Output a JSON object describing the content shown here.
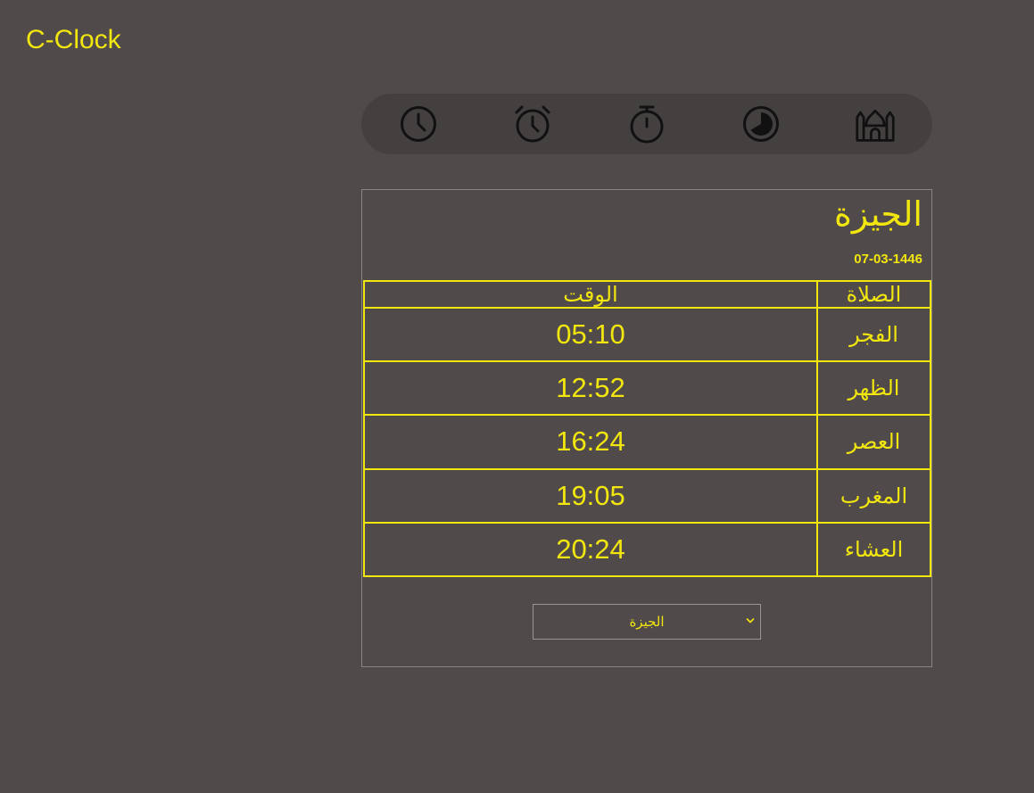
{
  "app": {
    "brand": "C-Clock"
  },
  "nav": {
    "items": [
      {
        "icon": "clock-icon"
      },
      {
        "icon": "alarm-clock-icon"
      },
      {
        "icon": "stopwatch-icon"
      },
      {
        "icon": "timer-icon"
      },
      {
        "icon": "mosque-icon"
      }
    ],
    "active_icon": "mosque-icon"
  },
  "prayer": {
    "city": "الجيزة",
    "hijri_date": "07-03-1446",
    "headers": {
      "prayer": "الصلاة",
      "time": "الوقت"
    },
    "rows": [
      {
        "name": "الفجر",
        "time": "05:10"
      },
      {
        "name": "الظهر",
        "time": "12:52"
      },
      {
        "name": "العصر",
        "time": "16:24"
      },
      {
        "name": "المغرب",
        "time": "19:05"
      },
      {
        "name": "العشاء",
        "time": "20:24"
      }
    ],
    "select": {
      "selected": "الجيزة"
    }
  },
  "colors": {
    "background": "#504a4a",
    "nav_background": "#444040",
    "accent": "#f2e60f",
    "border": "#8a8585"
  }
}
